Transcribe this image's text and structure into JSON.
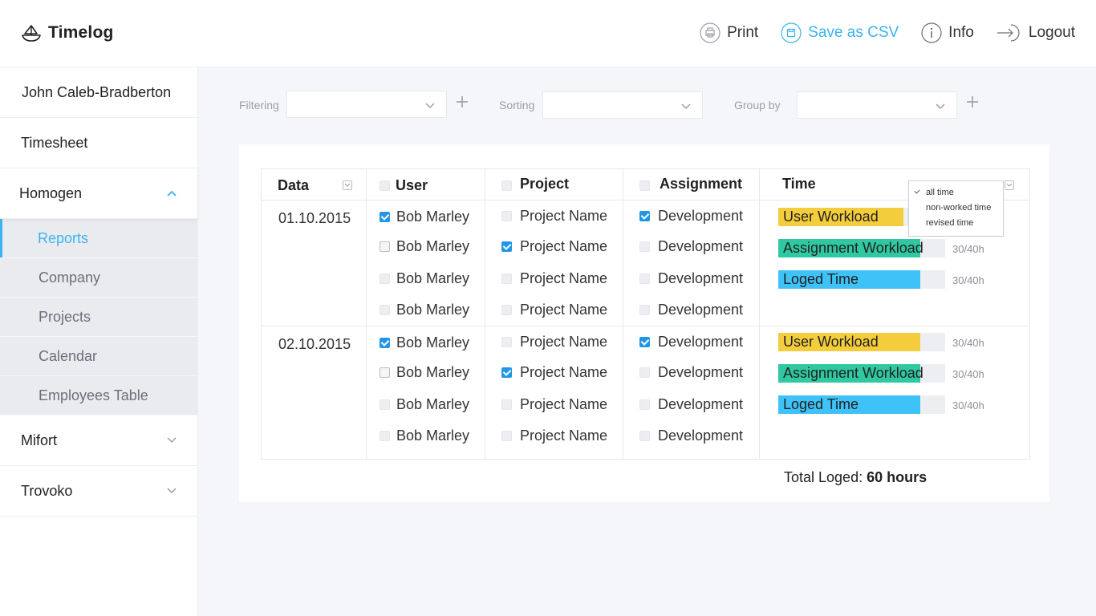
{
  "app": {
    "name": "Timelog"
  },
  "header": {
    "actions": [
      {
        "id": "print",
        "label": "Print"
      },
      {
        "id": "csv",
        "label": "Save as CSV"
      },
      {
        "id": "info",
        "label": "Info"
      },
      {
        "id": "logout",
        "label": "Logout"
      }
    ]
  },
  "sidebar": {
    "user": "John Caleb-Bradberton",
    "timesheet": "Timesheet",
    "groups": [
      {
        "label": "Homogen",
        "expanded": true,
        "items": [
          "Reports",
          "Company",
          "Projects",
          "Calendar",
          "Employees Table"
        ],
        "active": "Reports"
      },
      {
        "label": "Mifort",
        "expanded": false
      },
      {
        "label": "Trovoko",
        "expanded": false
      }
    ]
  },
  "filters": {
    "filtering_label": "Filtering",
    "sorting_label": "Sorting",
    "groupby_label": "Group by"
  },
  "table": {
    "headers": {
      "date": "Data",
      "user": "User",
      "project": "Project",
      "assignment": "Assignment",
      "time": "Time"
    },
    "groups": [
      {
        "date": "01.10.2015",
        "rows": [
          {
            "user": "Bob Marley",
            "user_checked": true,
            "project": "Project Name",
            "project_checked": false,
            "assignment": "Development",
            "assignment_checked": true
          },
          {
            "user": "Bob Marley",
            "user_checked": false,
            "project": "Project Name",
            "project_checked": true,
            "assignment": "Development",
            "assignment_checked": false
          },
          {
            "user": "Bob Marley",
            "user_checked": false,
            "project": "Project Name",
            "project_checked": false,
            "assignment": "Development",
            "assignment_checked": false
          },
          {
            "user": "Bob Marley",
            "user_checked": false,
            "project": "Project Name",
            "project_checked": false,
            "assignment": "Development",
            "assignment_checked": false
          }
        ],
        "bars": [
          {
            "label": "User Workload",
            "value": "30/40h",
            "fraction": 0.75,
            "color": "#f4cd3c"
          },
          {
            "label": "Assignment  Workload",
            "value": "30/40h",
            "fraction": 0.85,
            "color": "#2fc8a0"
          },
          {
            "label": "Loged Time",
            "value": "30/40h",
            "fraction": 0.85,
            "color": "#3ec2f7"
          }
        ]
      },
      {
        "date": "02.10.2015",
        "rows": [
          {
            "user": "Bob Marley",
            "user_checked": true,
            "project": "Project Name",
            "project_checked": false,
            "assignment": "Development",
            "assignment_checked": true
          },
          {
            "user": "Bob Marley",
            "user_checked": false,
            "project": "Project Name",
            "project_checked": true,
            "assignment": "Development",
            "assignment_checked": false
          },
          {
            "user": "Bob Marley",
            "user_checked": false,
            "project": "Project Name",
            "project_checked": false,
            "assignment": "Development",
            "assignment_checked": false
          },
          {
            "user": "Bob Marley",
            "user_checked": false,
            "project": "Project Name",
            "project_checked": false,
            "assignment": "Development",
            "assignment_checked": false
          }
        ],
        "bars": [
          {
            "label": "User Workload",
            "value": "30/40h",
            "fraction": 0.85,
            "color": "#f4cd3c"
          },
          {
            "label": "Assignment  Workload",
            "value": "30/40h",
            "fraction": 0.85,
            "color": "#2fc8a0"
          },
          {
            "label": "Loged Time",
            "value": "30/40h",
            "fraction": 0.85,
            "color": "#3ec2f7"
          }
        ]
      }
    ],
    "total_label": "Total Loged:",
    "total_value": "60 hours"
  },
  "time_dropdown": {
    "options": [
      "all time",
      "non-worked time",
      "revised time"
    ],
    "selected": "all time"
  }
}
